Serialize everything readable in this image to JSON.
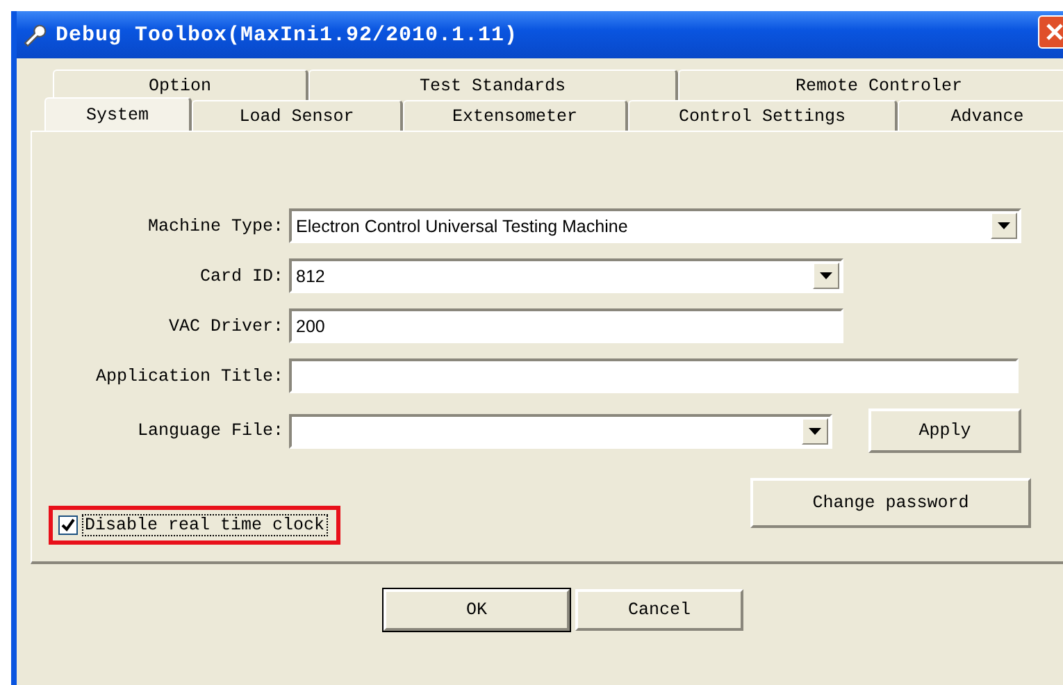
{
  "window": {
    "title": "Debug Toolbox(MaxIni1.92/2010.1.11)"
  },
  "tab_rows": [
    [
      {
        "label": "Option",
        "selected": false
      },
      {
        "label": "Test Standards",
        "selected": false
      },
      {
        "label": "Remote Controler",
        "selected": false
      }
    ],
    [
      {
        "label": "System",
        "selected": true
      },
      {
        "label": "Load Sensor",
        "selected": false
      },
      {
        "label": "Extensometer",
        "selected": false
      },
      {
        "label": "Control Settings",
        "selected": false
      },
      {
        "label": "Advance",
        "selected": false
      }
    ]
  ],
  "fields": [
    {
      "kind": "combo",
      "label": "Machine Type:",
      "value": "Electron Control Universal Testing Machine"
    },
    {
      "kind": "combo",
      "label": "Card ID:",
      "value": "812"
    },
    {
      "kind": "text",
      "label": "VAC Driver:",
      "value": "200"
    },
    {
      "kind": "text",
      "label": "Application Title:"
    },
    {
      "kind": "combo",
      "label": "Language File:",
      "button": "Apply"
    }
  ],
  "change_password": "Change password",
  "checkbox": {
    "label": "Disable real time clock",
    "checked": true,
    "highlighted": true
  },
  "buttons": [
    {
      "label": "OK",
      "default": true
    },
    {
      "label": "Cancel",
      "default": false
    }
  ]
}
